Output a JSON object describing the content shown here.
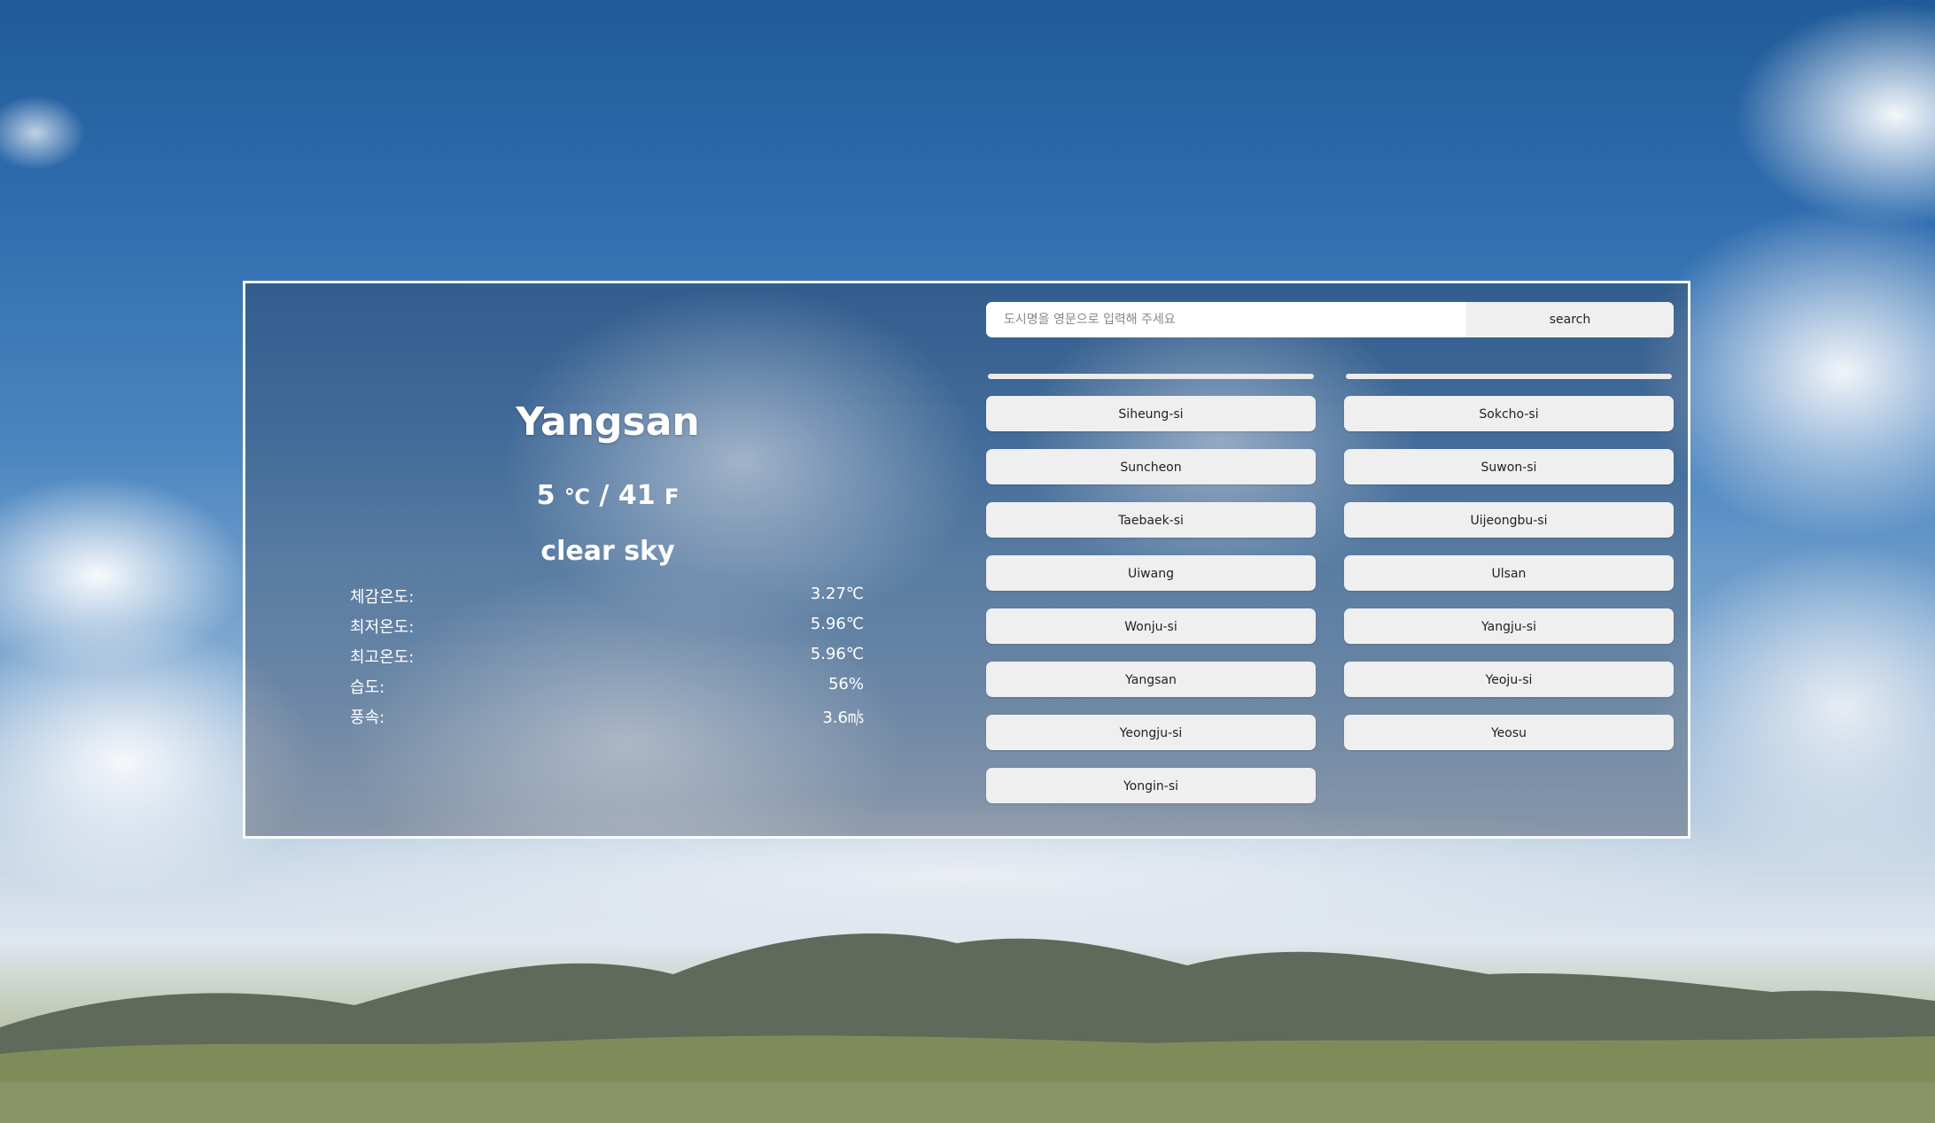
{
  "weather": {
    "city": "Yangsan",
    "temp_c": "5",
    "unit_c": "℃",
    "separator": "/",
    "temp_f": "41",
    "unit_f": "F",
    "description": "clear sky",
    "details": [
      {
        "label": "체감온도:",
        "value": "3.27℃"
      },
      {
        "label": "최저온도:",
        "value": "5.96℃"
      },
      {
        "label": "최고온도:",
        "value": "5.96℃"
      },
      {
        "label": "습도:",
        "value": "56%"
      },
      {
        "label": "풍속:",
        "value": "3.6㎧"
      }
    ]
  },
  "search": {
    "placeholder": "도시명을 영문으로 입력해 주세요",
    "button_label": "search"
  },
  "cities": [
    "Siheung-si",
    "Sokcho-si",
    "Suncheon",
    "Suwon-si",
    "Taebaek-si",
    "Uijeongbu-si",
    "Uiwang",
    "Ulsan",
    "Wonju-si",
    "Yangju-si",
    "Yangsan",
    "Yeoju-si",
    "Yeongju-si",
    "Yeosu",
    "Yongin-si"
  ]
}
